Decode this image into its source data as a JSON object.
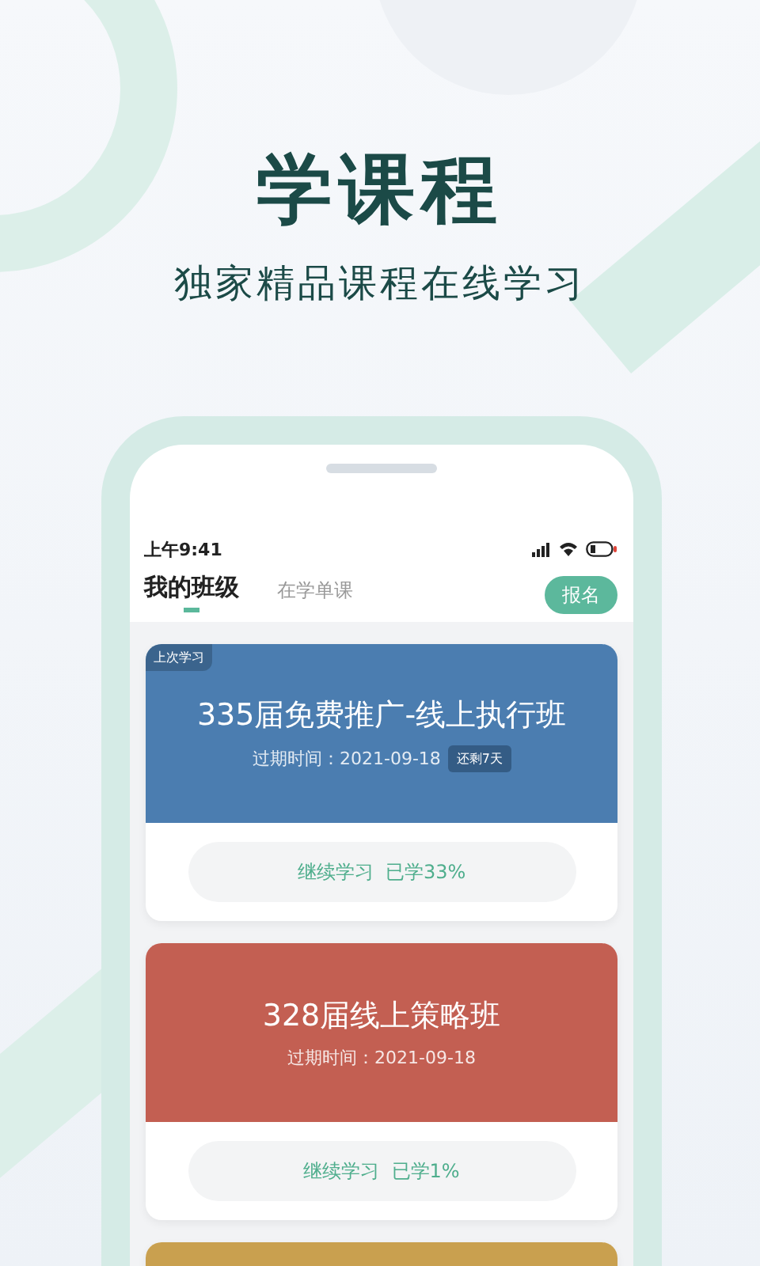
{
  "headline": "学课程",
  "subtitle": "独家精品课程在线学习",
  "status_bar": {
    "time": "上午9:41"
  },
  "tabs": [
    {
      "label": "我的班级",
      "selected": true
    },
    {
      "label": "在学单课",
      "selected": false
    }
  ],
  "enroll_button": "报名",
  "classes": [
    {
      "tag": "上次学习",
      "title": "335届免费推广-线上执行班",
      "expiry": "过期时间：2021-09-18",
      "remaining": "还剩7天",
      "color": "#4b7db0",
      "action": "继续学习  已学33%"
    },
    {
      "title": "328届线上策略班",
      "expiry": "过期时间：2021-09-18",
      "color": "#c35f52",
      "action": "继续学习  已学1%"
    },
    {
      "color": "#c9a04f"
    }
  ]
}
